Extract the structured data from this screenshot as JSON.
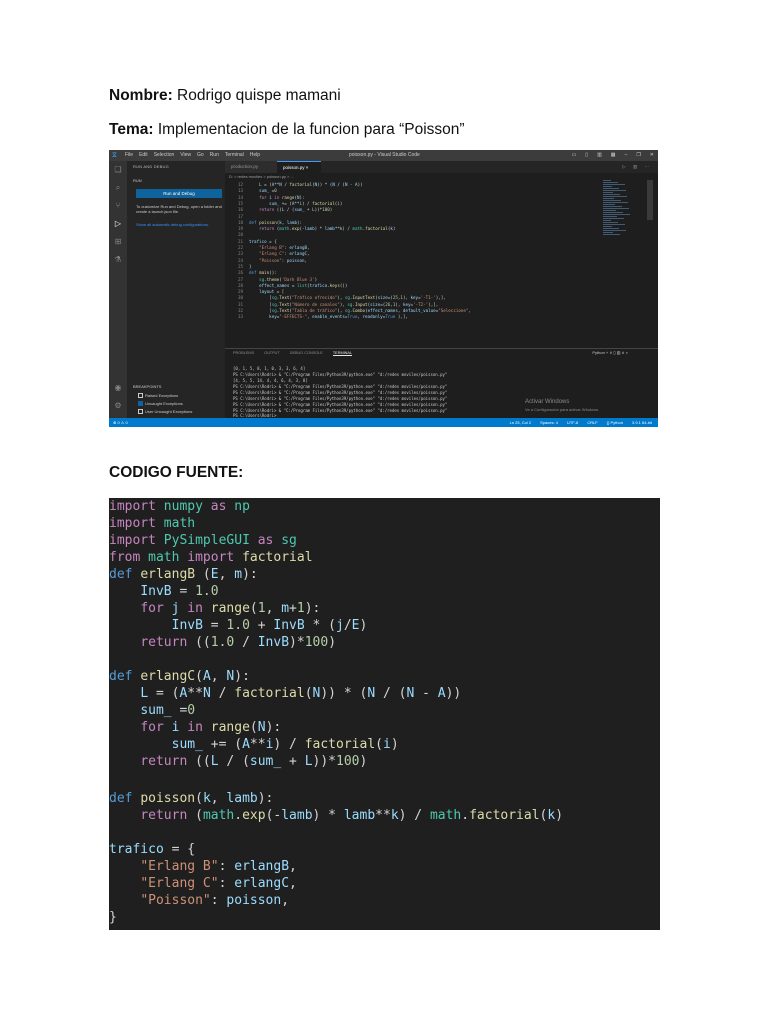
{
  "header": {
    "nombre_label": "Nombre:",
    "nombre_value": "Rodrigo quispe mamani",
    "tema_label": "Tema:",
    "tema_value": "Implementacion de la funcion para “Poisson”",
    "codigo_label": "CODIGO FUENTE:"
  },
  "vscode": {
    "menu": [
      "File",
      "Edit",
      "Selection",
      "View",
      "Go",
      "Run",
      "Terminal",
      "Help"
    ],
    "window_title": "poisson.py - Visual Studio Code",
    "sidebar_title": "RUN AND DEBUG",
    "sidebar_section": "RUN",
    "run_button": "Run and Debug",
    "sidebar_text1": "To customize Run and Debug, open a folder and create a launch.json file.",
    "sidebar_text2": "Show all automatic debug configurations.",
    "breakpoints_title": "BREAKPOINTS",
    "breakpoints": [
      "Raised Exceptions",
      "Uncaught Exceptions",
      "User Uncaught Exceptions"
    ],
    "tabs": [
      "production.py",
      "poisson.py ×"
    ],
    "breadcrumb": "D: > redes moviles > poisson.py > ...",
    "line_numbers": [
      "12",
      "13",
      "14",
      "15",
      "16",
      "17",
      "18",
      "19",
      "20",
      "21",
      "22",
      "23",
      "24",
      "25",
      "26",
      "27",
      "28",
      "29",
      "30",
      "31",
      "32",
      "33"
    ],
    "panel_tabs": [
      "PROBLEMS",
      "OUTPUT",
      "DEBUG CONSOLE",
      "TERMINAL"
    ],
    "panel_right": "Python  +  ∨  ▯  ▥  ∧  ×",
    "terminal_lines": [
      "[0, 1, 5, 8, 1, 0, 3, 3, 6, 4]",
      "PS C:\\Users\\Rodri> & \"C:/Program Files/Python39/python.exe\" \"d:/redes moviles/poisson.py\"",
      "[4, 5, 5, 14, 4, 4, 6, 4, 3, 8]",
      "PS C:\\Users\\Rodri> & \"C:/Program Files/Python39/python.exe\" \"d:/redes moviles/poisson.py\"",
      "PS C:\\Users\\Rodri> & \"C:/Program Files/Python39/python.exe\" \"d:/redes moviles/poisson.py\"",
      "PS C:\\Users\\Rodri> & \"C:/Program Files/Python39/python.exe\" \"d:/redes moviles/poisson.py\"",
      "PS C:\\Users\\Rodri> & \"C:/Program Files/Python39/python.exe\" \"d:/redes moviles/poisson.py\"",
      "PS C:\\Users\\Rodri> & \"C:/Program Files/Python39/python.exe\" \"d:/redes moviles/poisson.py\"",
      "PS C:\\Users\\Rodri> "
    ],
    "activate_title": "Activar Windows",
    "activate_sub": "Ve a Configuración para activar Windows.",
    "status_left": "⊗ 0 ⚠ 0",
    "status_right": [
      "Ln 25, Col 2",
      "Spaces: 4",
      "UTF-8",
      "CRLF",
      "{} Python",
      "3.9.1 64-bit"
    ]
  }
}
